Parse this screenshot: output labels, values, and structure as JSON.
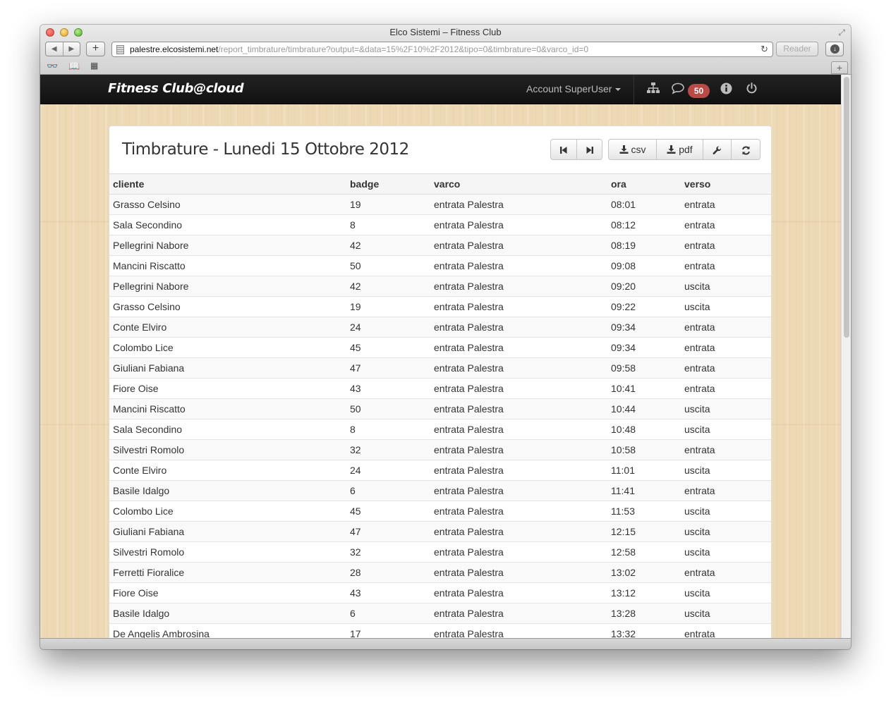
{
  "window": {
    "title": "Elco Sistemi – Fitness Club"
  },
  "browser": {
    "url_host": "palestre.elcosistemi.net",
    "url_path": "/report_timbrature/timbrature?output=&data=15%2F10%2F2012&tipo=0&timbrature=0&varco_id=0",
    "reader_label": "Reader"
  },
  "navbar": {
    "brand": "Fitness Club@cloud",
    "account_label": "Account SuperUser",
    "messages_count": "50"
  },
  "panel": {
    "title": "Timbrature - Lunedi 15 Ottobre 2012",
    "csv_label": "csv",
    "pdf_label": "pdf"
  },
  "table": {
    "columns": [
      "cliente",
      "badge",
      "varco",
      "ora",
      "verso"
    ],
    "rows": [
      [
        "Grasso Celsino",
        "19",
        "entrata Palestra",
        "08:01",
        "entrata"
      ],
      [
        "Sala Secondino",
        "8",
        "entrata Palestra",
        "08:12",
        "entrata"
      ],
      [
        "Pellegrini Nabore",
        "42",
        "entrata Palestra",
        "08:19",
        "entrata"
      ],
      [
        "Mancini Riscatto",
        "50",
        "entrata Palestra",
        "09:08",
        "entrata"
      ],
      [
        "Pellegrini Nabore",
        "42",
        "entrata Palestra",
        "09:20",
        "uscita"
      ],
      [
        "Grasso Celsino",
        "19",
        "entrata Palestra",
        "09:22",
        "uscita"
      ],
      [
        "Conte Elviro",
        "24",
        "entrata Palestra",
        "09:34",
        "entrata"
      ],
      [
        "Colombo Lice",
        "45",
        "entrata Palestra",
        "09:34",
        "entrata"
      ],
      [
        "Giuliani Fabiana",
        "47",
        "entrata Palestra",
        "09:58",
        "entrata"
      ],
      [
        "Fiore Oise",
        "43",
        "entrata Palestra",
        "10:41",
        "entrata"
      ],
      [
        "Mancini Riscatto",
        "50",
        "entrata Palestra",
        "10:44",
        "uscita"
      ],
      [
        "Sala Secondino",
        "8",
        "entrata Palestra",
        "10:48",
        "uscita"
      ],
      [
        "Silvestri Romolo",
        "32",
        "entrata Palestra",
        "10:58",
        "entrata"
      ],
      [
        "Conte Elviro",
        "24",
        "entrata Palestra",
        "11:01",
        "uscita"
      ],
      [
        "Basile Idalgo",
        "6",
        "entrata Palestra",
        "11:41",
        "entrata"
      ],
      [
        "Colombo Lice",
        "45",
        "entrata Palestra",
        "11:53",
        "uscita"
      ],
      [
        "Giuliani Fabiana",
        "47",
        "entrata Palestra",
        "12:15",
        "uscita"
      ],
      [
        "Silvestri Romolo",
        "32",
        "entrata Palestra",
        "12:58",
        "uscita"
      ],
      [
        "Ferretti Fioralice",
        "28",
        "entrata Palestra",
        "13:02",
        "entrata"
      ],
      [
        "Fiore Oise",
        "43",
        "entrata Palestra",
        "13:12",
        "uscita"
      ],
      [
        "Basile Idalgo",
        "6",
        "entrata Palestra",
        "13:28",
        "uscita"
      ],
      [
        "De Angelis Ambrosina",
        "17",
        "entrata Palestra",
        "13:32",
        "entrata"
      ]
    ]
  },
  "colors": {
    "navbar_bg": "#1b1b1b",
    "badge": "#b94a48",
    "wood_bg": "#eed9b5"
  },
  "icons": [
    "close-dot",
    "minimize-dot",
    "zoom-dot",
    "back-arrow-icon",
    "forward-arrow-icon",
    "plus-icon",
    "reload-icon",
    "download-icon",
    "reading-list-icon",
    "bookmarks-book-icon",
    "top-sites-grid-icon",
    "sitemap-icon",
    "comment-icon",
    "info-icon",
    "power-icon",
    "step-backward-icon",
    "step-forward-icon",
    "download-icon",
    "wrench-icon",
    "refresh-icon"
  ]
}
